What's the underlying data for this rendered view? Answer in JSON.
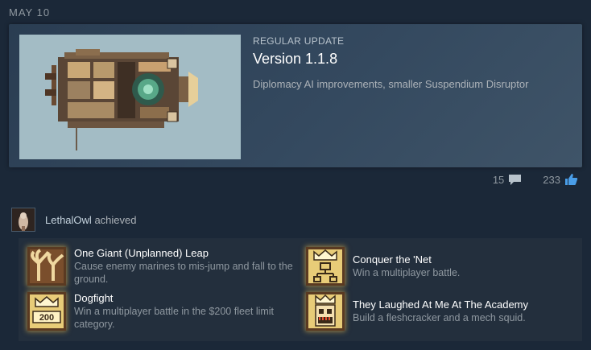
{
  "date": "MAY 10",
  "news": {
    "type": "REGULAR UPDATE",
    "title": "Version 1.1.8",
    "description": "Diplomacy AI improvements, smaller Suspendium Disruptor"
  },
  "stats": {
    "comments": "15",
    "likes": "233"
  },
  "activity": {
    "username": "LethalOwl",
    "action": "achieved"
  },
  "achievements": [
    {
      "name": "One Giant (Unplanned) Leap",
      "description": "Cause enemy marines to mis-jump and fall to the ground.",
      "icon": "palm-tree-icon"
    },
    {
      "name": "Conquer the 'Net",
      "description": "Win a multiplayer battle.",
      "icon": "crown-network-icon"
    },
    {
      "name": "Dogfight",
      "description": "Win a multiplayer battle in the $200 fleet limit category.",
      "icon": "crown-200-icon",
      "badge": "200"
    },
    {
      "name": "They Laughed At Me At The Academy",
      "description": "Build a fleshcracker and a mech squid.",
      "icon": "skull-crown-icon"
    }
  ],
  "colors": {
    "accent_like": "#4a9ee8",
    "achievement_glow": "#ffc850"
  }
}
